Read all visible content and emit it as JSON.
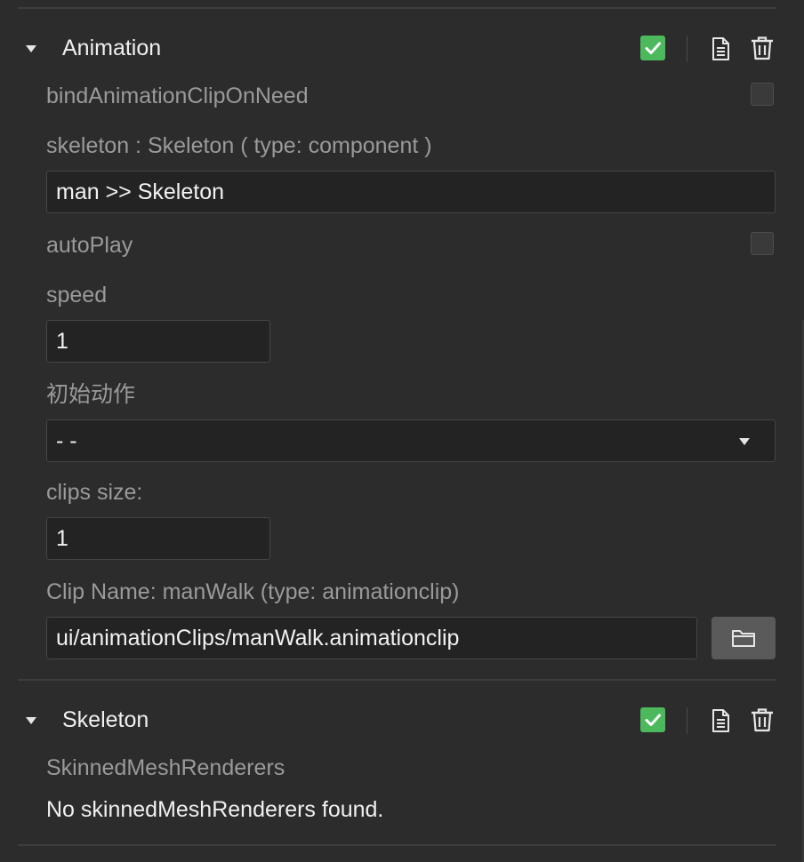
{
  "animation": {
    "title": "Animation",
    "enabled": true,
    "properties": {
      "bind_clip_label": "bindAnimationClipOnNeed",
      "bind_clip_checked": false,
      "skeleton_label": "skeleton : Skeleton ( type: component )",
      "skeleton_value": "man >> Skeleton",
      "autoplay_label": "autoPlay",
      "autoplay_checked": false,
      "speed_label": "speed",
      "speed_value": "1",
      "initial_action_label": "初始动作",
      "initial_action_value": "- -",
      "clips_size_label": "clips size:",
      "clips_size_value": "1",
      "clip_name_label": "Clip Name: manWalk (type: animationclip)",
      "clip_path_value": "ui/animationClips/manWalk.animationclip"
    }
  },
  "skeleton": {
    "title": "Skeleton",
    "enabled": true,
    "renderers_label": "SkinnedMeshRenderers",
    "renderers_empty_text": "No skinnedMeshRenderers found."
  },
  "icons": {
    "collapse": "caret-down-icon",
    "enable": "check-icon",
    "doc": "document-icon",
    "delete": "trash-icon",
    "browse": "folder-icon",
    "dropdown": "chevron-down-icon"
  },
  "colors": {
    "background": "#2c2c2c",
    "check_green": "#4cb95c",
    "field_bg": "#232323",
    "label": "#9a9a9a",
    "value": "#f2f2f2"
  }
}
